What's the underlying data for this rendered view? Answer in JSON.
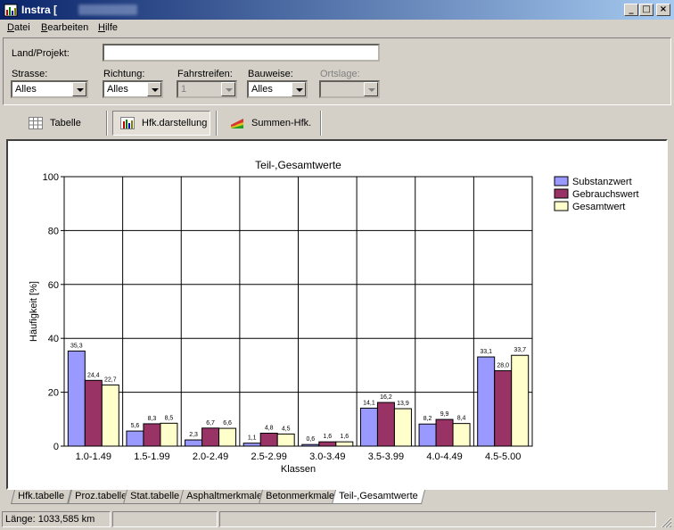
{
  "window": {
    "title": "Instra [",
    "min_label": "_",
    "max_label": "□",
    "close_label": "×"
  },
  "menu": [
    {
      "accel": "D",
      "rest": "atei"
    },
    {
      "accel": "B",
      "rest": "earbeiten"
    },
    {
      "accel": "H",
      "rest": "ilfe"
    }
  ],
  "filters": {
    "land_projekt_label": "Land/Projekt:",
    "land_projekt_value": "",
    "strasse_label": "Strasse:",
    "strasse_value": "Alles",
    "richtung_label": "Richtung:",
    "richtung_value": "Alles",
    "fahrstreifen_label": "Fahrstreifen:",
    "fahrstreifen_value": "1",
    "bauweise_label": "Bauweise:",
    "bauweise_value": "Alles",
    "ortslage_label": "Ortslage:",
    "ortslage_value": ""
  },
  "toolbar": {
    "tabelle_label": "Tabelle",
    "hfk_label": "Hfk.darstellung",
    "summen_label": "Summen-Hfk."
  },
  "chart_data": {
    "type": "bar",
    "title": "Teil-,Gesamtwerte",
    "xlabel": "Klassen",
    "ylabel": "Häufigkeit [%]",
    "ylim": [
      0,
      100
    ],
    "yticks": [
      "0",
      "20",
      "40",
      "60",
      "80",
      "100"
    ],
    "grid": true,
    "legend_position": "top-right",
    "categories": [
      "1.0-1.49",
      "1.5-1.99",
      "2.0-2.49",
      "2.5-2.99",
      "3.0-3.49",
      "3.5-3.99",
      "4.0-4.49",
      "4.5-5.00"
    ],
    "series": [
      {
        "name": "Substanzwert",
        "color": "#9999ff",
        "values": [
          35.3,
          5.6,
          2.3,
          1.1,
          0.6,
          14.1,
          8.2,
          33.1
        ],
        "labels": [
          "35,3",
          "5,6",
          "2,3",
          "1,1",
          "0,6",
          "14,1",
          "8,2",
          "33,1"
        ]
      },
      {
        "name": "Gebrauchswert",
        "color": "#993366",
        "values": [
          24.4,
          8.3,
          6.7,
          4.8,
          1.6,
          16.2,
          9.9,
          28.0
        ],
        "labels": [
          "24,4",
          "8,3",
          "6,7",
          "4,8",
          "1,6",
          "16,2",
          "9,9",
          "28,0"
        ]
      },
      {
        "name": "Gesamtwert",
        "color": "#ffffcc",
        "values": [
          22.7,
          8.5,
          6.6,
          4.5,
          1.6,
          13.9,
          8.4,
          33.7
        ],
        "labels": [
          "22,7",
          "8,5",
          "6,6",
          "4,5",
          "1,6",
          "13,9",
          "8,4",
          "33,7"
        ]
      }
    ]
  },
  "sheet_tabs": [
    "Hfk.tabelle",
    "Proz.tabelle",
    "Stat.tabelle",
    "Asphaltmerkmale",
    "Betonmerkmale",
    "Teil-,Gesamtwerte"
  ],
  "status": {
    "length_text": "Länge: 1033,585 km"
  }
}
